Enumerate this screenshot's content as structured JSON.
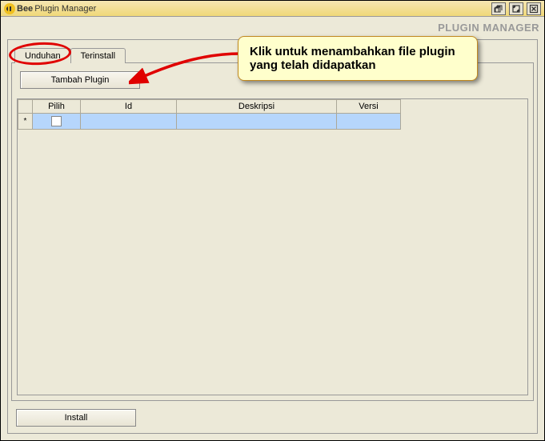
{
  "window": {
    "logo_text": "Bee",
    "title": "Plugin Manager"
  },
  "header_label": "PLUGIN MANAGER",
  "tabs": {
    "download": "Unduhan",
    "installed": "Terinstall"
  },
  "buttons": {
    "add_plugin": "Tambah Plugin",
    "install": "Install"
  },
  "table": {
    "headers": {
      "pilih": "Pilih",
      "id": "Id",
      "deskripsi": "Deskripsi",
      "versi": "Versi"
    },
    "row_marker": "*"
  },
  "annotation": {
    "callout": "Klik untuk menambahkan file plugin yang telah didapatkan"
  }
}
